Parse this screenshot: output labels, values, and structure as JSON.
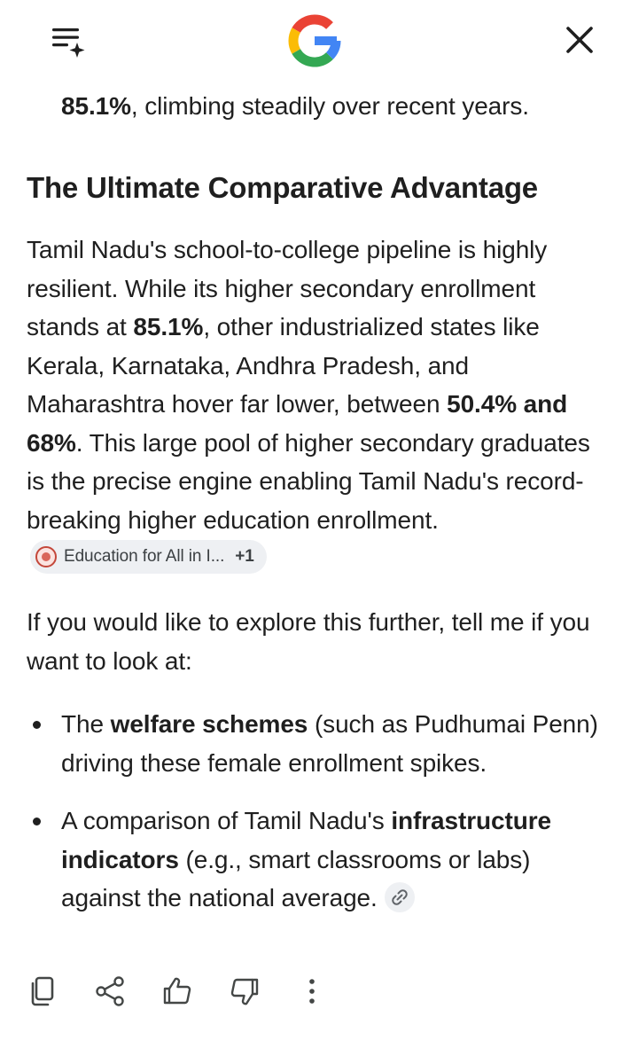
{
  "topbar": {
    "menu_icon": "menu-sparkle-icon",
    "logo": "google-g-logo",
    "close_icon": "close-icon",
    "brand_colors": [
      "#4285F4",
      "#EA4335",
      "#FBBC05",
      "#34A853"
    ]
  },
  "article": {
    "intro": {
      "bold": "85.1%",
      "rest": ", climbing steadily over recent years."
    },
    "heading": "The Ultimate Comparative Advantage",
    "para1": {
      "t1": "Tamil Nadu's school-to-college pipeline is highly resilient. While its higher secondary enrollment stands at ",
      "b1": "85.1%",
      "t2": ", other industrialized states like Kerala, Karnataka, Andhra Pradesh, and Maharashtra hover far lower, between ",
      "b2": "50.4% and 68%",
      "t3": ". This large pool of higher secondary graduates is the precise engine enabling Tamil Nadu's record-breaking higher education enrollment."
    },
    "source_chip": {
      "label": "Education for All in I...",
      "more": "+1"
    },
    "para2": "If you would like to explore this further, tell me if you want to look at:",
    "bullets": [
      {
        "t1": "The ",
        "b": "welfare schemes",
        "t2": " (such as Pudhumai Penn) driving these female enrollment spikes."
      },
      {
        "t1": "A comparison of Tamil Nadu's ",
        "b": "infrastructure indicators",
        "t2": " (e.g., smart classrooms or labs) against the national average."
      }
    ],
    "link_icon": "link-icon"
  },
  "actions": {
    "icons": [
      "copy-icon",
      "share-icon",
      "thumbs-up-icon",
      "thumbs-down-icon",
      "more-vert-icon"
    ]
  }
}
